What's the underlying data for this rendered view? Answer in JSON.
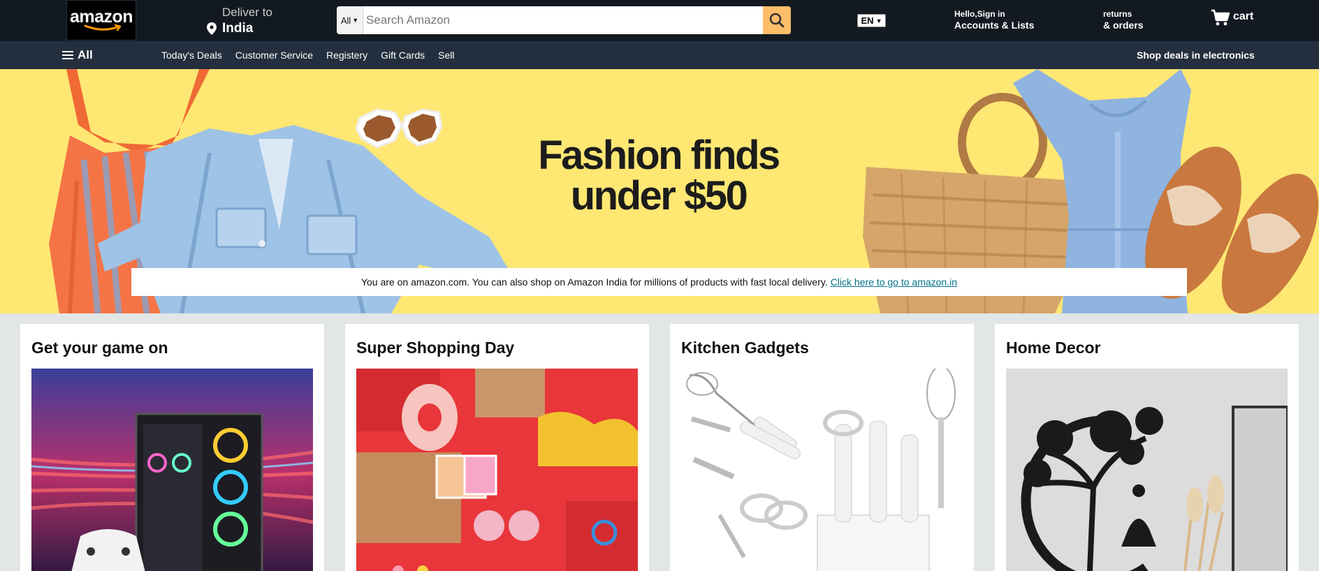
{
  "header": {
    "logo_text": "amazon",
    "deliver_label": "Deliver to",
    "deliver_country": "India",
    "search": {
      "category": "All",
      "placeholder": "Search Amazon"
    },
    "language": "EN",
    "account_line1": "Hello,Sign in",
    "account_line2": "Accounts & Lists",
    "returns_line1": "returns",
    "returns_line2": "& orders",
    "cart_label": "cart"
  },
  "subnav": {
    "all_label": "All",
    "links": [
      "Today's Deals",
      "Customer Service",
      "Registery",
      "Gift Cards",
      "Sell"
    ],
    "promo": "Shop deals in electronics"
  },
  "hero": {
    "title_line1": "Fashion finds",
    "title_line2": "under $50",
    "notice_text": "You are on amazon.com. You can also shop on Amazon India for millions of products with fast local delivery.",
    "notice_link": "Click here to go to amazon.in"
  },
  "cards": [
    {
      "title": "Get your game on",
      "image": "gaming-pc"
    },
    {
      "title": "Super Shopping Day",
      "image": "shopping-products"
    },
    {
      "title": "Kitchen Gadgets",
      "image": "kitchen-utensils"
    },
    {
      "title": "Home Decor",
      "image": "tree-wall-art"
    }
  ],
  "colors": {
    "nav_bg": "#131921",
    "subnav_bg": "#232f3e",
    "search_button": "#febd69",
    "hero_bg": "#fee773",
    "link": "#007185",
    "page_bg": "#e3e6e6"
  }
}
